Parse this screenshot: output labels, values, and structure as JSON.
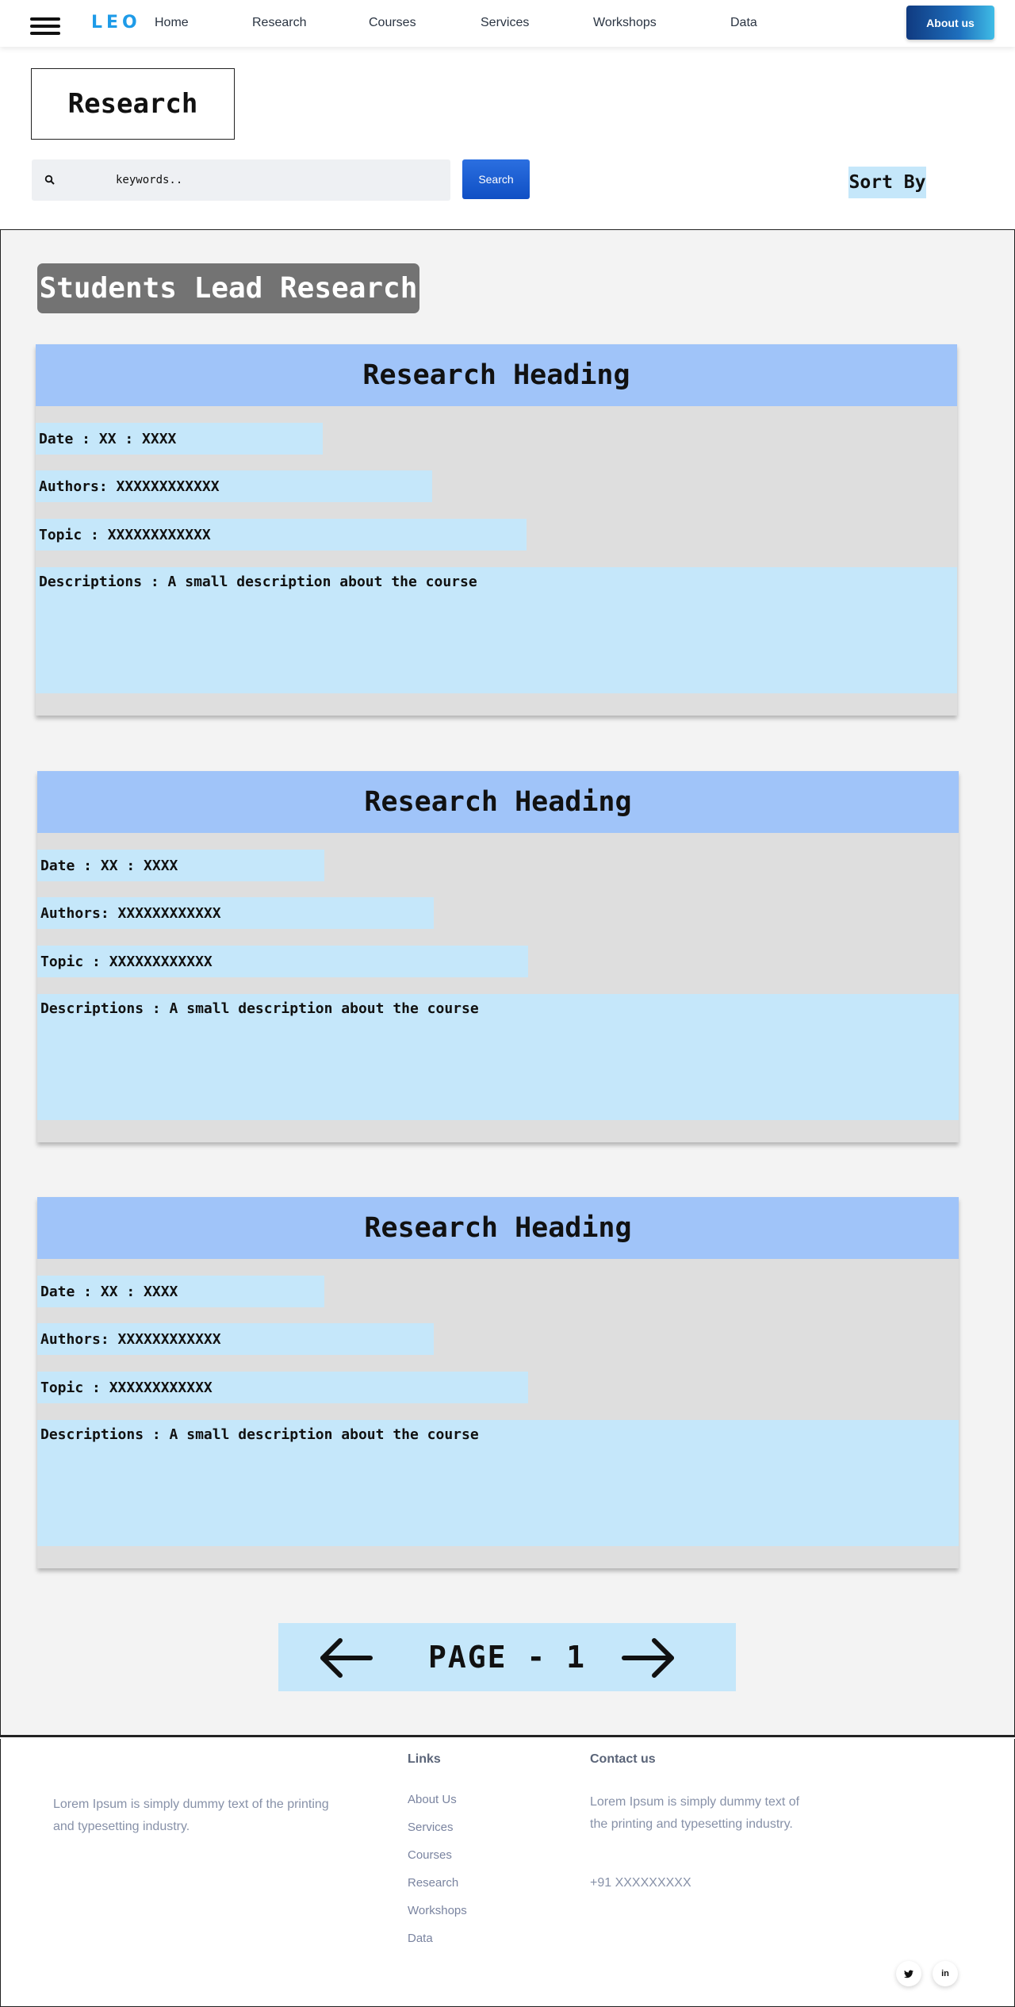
{
  "navbar": {
    "logo": "LEO",
    "items": [
      {
        "label": "Home"
      },
      {
        "label": "Research"
      },
      {
        "label": "Courses"
      },
      {
        "label": "Services"
      },
      {
        "label": "Workshops"
      },
      {
        "label": "Data"
      }
    ],
    "about_label": "About us"
  },
  "page_title": "Research",
  "search": {
    "placeholder": "keywords..",
    "button_label": "Search",
    "icon": "search-icon"
  },
  "sort_label": "Sort By",
  "section_label": "Students Lead Research",
  "cards": [
    {
      "heading": "Research Heading",
      "date": "Date : XX : XXXX",
      "authors": "Authors: XXXXXXXXXXXX",
      "topic": "Topic : XXXXXXXXXXXX",
      "description": "Descriptions : A small description about the course"
    },
    {
      "heading": "Research Heading",
      "date": "Date : XX : XXXX",
      "authors": "Authors: XXXXXXXXXXXX",
      "topic": "Topic : XXXXXXXXXXXX",
      "description": "Descriptions : A small description about the course"
    },
    {
      "heading": "Research Heading",
      "date": "Date : XX : XXXX",
      "authors": "Authors: XXXXXXXXXXXX",
      "topic": "Topic : XXXXXXXXXXXX",
      "description": "Descriptions : A small description about the course"
    }
  ],
  "pagination": {
    "label": "PAGE - 1",
    "prev_icon": "arrow-left-icon",
    "next_icon": "arrow-right-icon"
  },
  "footer": {
    "about_text": "Lorem Ipsum is simply dummy text of the printing and typesetting industry.",
    "links_heading": "Links",
    "links": [
      "About Us",
      "Services",
      "Courses",
      "Research",
      "Workshops",
      "Data"
    ],
    "contact_heading": "Contact us",
    "contact_text": "Lorem Ipsum is simply dummy text of the printing and typesetting industry.",
    "phone": "+91 XXXXXXXXX",
    "social": [
      {
        "icon": "twitter-icon"
      },
      {
        "icon": "linkedin-icon",
        "label": "in"
      }
    ]
  },
  "colors": {
    "brand": "#1e9be8",
    "card_heading_bg": "#a0c4f9",
    "field_bg": "#c5e7fa",
    "card_bg": "#dedede",
    "section_label_bg": "#737373"
  }
}
